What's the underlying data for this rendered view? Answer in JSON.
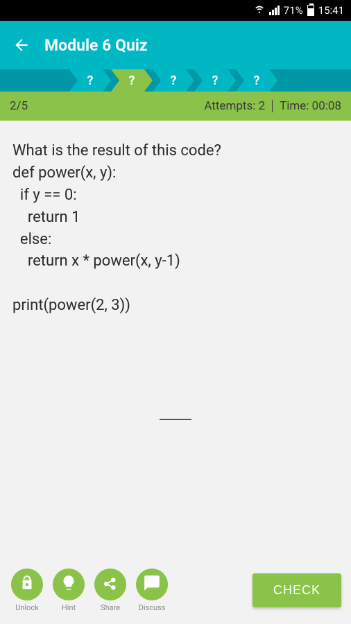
{
  "status": {
    "battery_pct": "71%",
    "time": "15:41"
  },
  "header": {
    "title": "Module 6 Quiz"
  },
  "progress": {
    "items": [
      "?",
      "?",
      "?",
      "?",
      "?"
    ],
    "active_index": 1
  },
  "info": {
    "position": "2/5",
    "attempts_label": "Attempts: 2",
    "time_label": "Time: 00:08"
  },
  "question": {
    "prompt": "What is the result of this code?",
    "code": "def power(x, y):\n  if y == 0:\n    return 1\n  else:\n    return x * power(x, y-1)\n\nprint(power(2, 3))"
  },
  "toolbar": {
    "unlock": "Unlock",
    "hint": "Hint",
    "share": "Share",
    "discuss": "Discuss",
    "check": "CHECK"
  }
}
